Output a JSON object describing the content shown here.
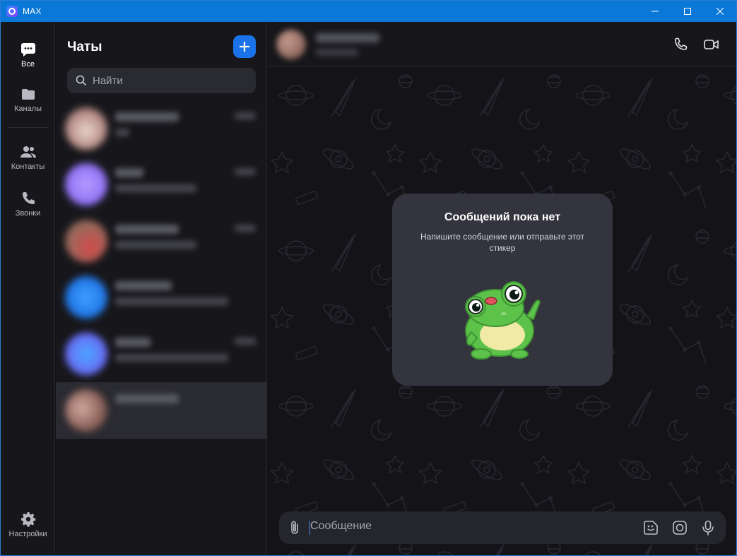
{
  "window": {
    "title": "MAX",
    "accent": "#0a78d7"
  },
  "rail": {
    "items": [
      {
        "label": "Все",
        "icon": "chat-bubble-icon",
        "active": true
      },
      {
        "label": "Каналы",
        "icon": "folder-icon",
        "active": false
      },
      {
        "label": "Контакты",
        "icon": "contacts-icon",
        "active": false
      },
      {
        "label": "Звонки",
        "icon": "phone-icon",
        "active": false
      }
    ],
    "settings_label": "Настройки"
  },
  "chatlist": {
    "title": "Чаты",
    "search_placeholder": "Найти",
    "new_chat_icon": "plus-icon",
    "rows_blurred": 6,
    "selected_index": 5
  },
  "empty_state": {
    "title": "Сообщений пока нет",
    "subtitle": "Напишите сообщение или отправьте этот стикер",
    "sticker": "frog-sticker"
  },
  "composer": {
    "placeholder": "Сообщение",
    "value": ""
  },
  "colors": {
    "primary_button": "#1a73e8",
    "card_bg": "#34343f",
    "frog_green": "#5cc24a"
  }
}
